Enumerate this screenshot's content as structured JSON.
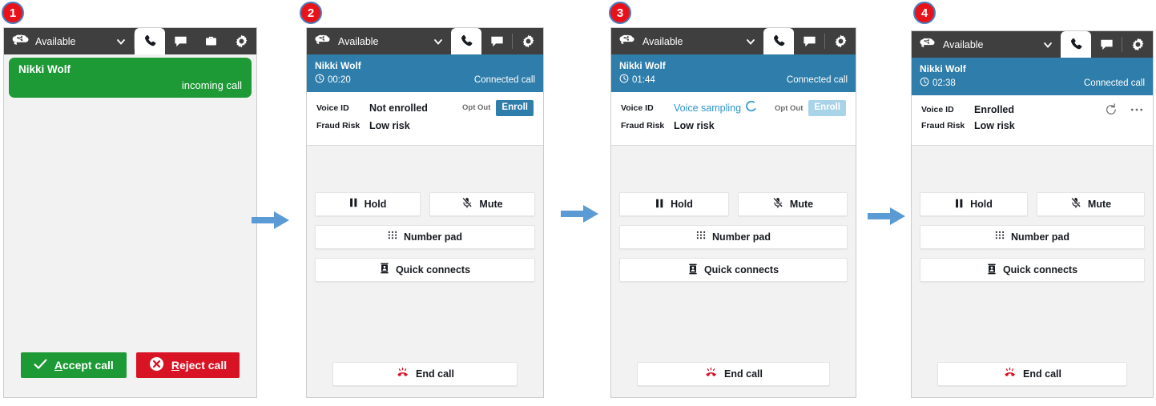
{
  "steps": [
    {
      "number": "1"
    },
    {
      "number": "2"
    },
    {
      "number": "3"
    },
    {
      "number": "4"
    }
  ],
  "colors": {
    "topbar": "#3f3f3f",
    "incoming_green": "#1d9a36",
    "connected_blue": "#2e7daa",
    "accent_blue": "#2e7daa",
    "sampling_teal": "#2e95c9",
    "enroll_disabled": "#a9d3e8",
    "reject_red": "#d81324",
    "badge_red": "#e8131a",
    "badge_ring": "#4a7ebb",
    "arrow_blue": "#5b9bd5",
    "panel_bg": "#f2f2f2"
  },
  "topbar": {
    "status_label": "Available",
    "logo_name": "amazon-connect-logo",
    "caret_name": "chevron-down-icon",
    "tabs_full": [
      "phone",
      "chat",
      "tasks",
      "settings"
    ],
    "tabs_compact": [
      "phone",
      "chat",
      "settings"
    ]
  },
  "panels": [
    {
      "id": "panel-1",
      "state": "incoming",
      "contact": {
        "name": "Nikki Wolf",
        "state_text": "incoming call"
      },
      "answer": {
        "accept_label": "Accept call",
        "accept_accesskey": "A",
        "reject_label": "Reject call",
        "reject_accesskey": "R"
      }
    },
    {
      "id": "panel-2",
      "state": "connected",
      "contact": {
        "name": "Nikki Wolf",
        "timer": "00:20",
        "state_text": "Connected call"
      },
      "voiceid": {
        "voice_id_label": "Voice ID",
        "voice_id_value": "Not enrolled",
        "fraud_label": "Fraud Risk",
        "fraud_value": "Low risk",
        "optout_label": "Opt Out",
        "enroll_label": "Enroll",
        "enroll_disabled": false,
        "show_spinner": false,
        "show_actions": false
      },
      "controls": {
        "hold": "Hold",
        "mute": "Mute",
        "number_pad": "Number pad",
        "quick_connects": "Quick connects",
        "end_call": "End call"
      }
    },
    {
      "id": "panel-3",
      "state": "connected",
      "contact": {
        "name": "Nikki Wolf",
        "timer": "01:44",
        "state_text": "Connected call"
      },
      "voiceid": {
        "voice_id_label": "Voice ID",
        "voice_id_value": "Voice sampling",
        "fraud_label": "Fraud Risk",
        "fraud_value": "Low risk",
        "optout_label": "Opt Out",
        "enroll_label": "Enroll",
        "enroll_disabled": true,
        "show_spinner": true,
        "show_actions": false
      },
      "controls": {
        "hold": "Hold",
        "mute": "Mute",
        "number_pad": "Number pad",
        "quick_connects": "Quick connects",
        "end_call": "End call"
      }
    },
    {
      "id": "panel-4",
      "state": "connected",
      "contact": {
        "name": "Nikki Wolf",
        "timer": "02:38",
        "state_text": "Connected call"
      },
      "voiceid": {
        "voice_id_label": "Voice ID",
        "voice_id_value": "Enrolled",
        "fraud_label": "Fraud Risk",
        "fraud_value": "Low risk",
        "optout_label": "",
        "enroll_label": "",
        "enroll_disabled": false,
        "show_spinner": false,
        "show_actions": true,
        "refresh_icon": "refresh-icon",
        "more_icon": "ellipsis-icon"
      },
      "controls": {
        "hold": "Hold",
        "mute": "Mute",
        "number_pad": "Number pad",
        "quick_connects": "Quick connects",
        "end_call": "End call"
      }
    }
  ],
  "arrows": [
    {
      "name": "arrow-1-to-2"
    },
    {
      "name": "arrow-2-to-3"
    },
    {
      "name": "arrow-3-to-4"
    }
  ]
}
